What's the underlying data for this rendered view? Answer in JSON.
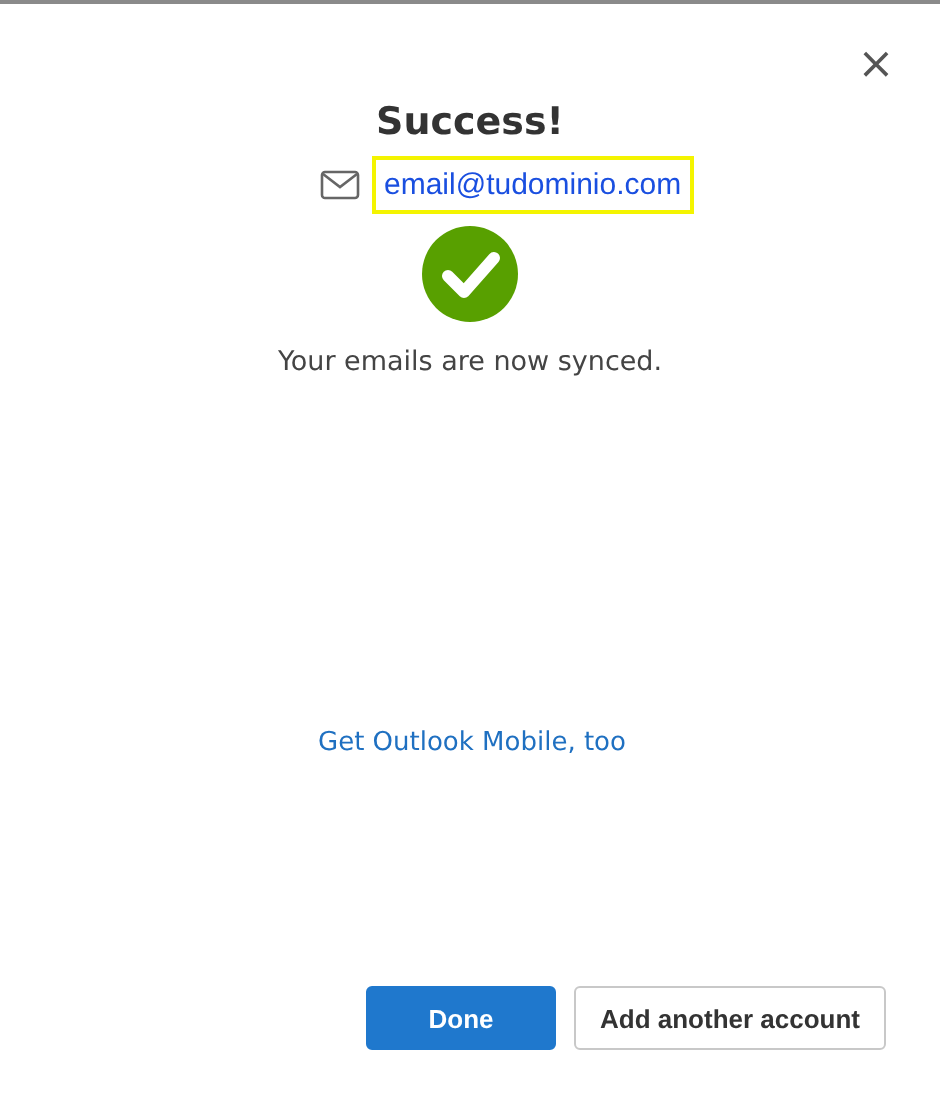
{
  "dialog": {
    "close": "×"
  },
  "title": "Success!",
  "account": {
    "email": "email@tudominio.com",
    "highlighted": true
  },
  "message": "Your emails are now synced.",
  "link": "Get Outlook Mobile, too",
  "buttons": [
    {
      "label": "Done",
      "primary": true
    },
    {
      "label": "Add another account",
      "primary": false
    }
  ]
}
